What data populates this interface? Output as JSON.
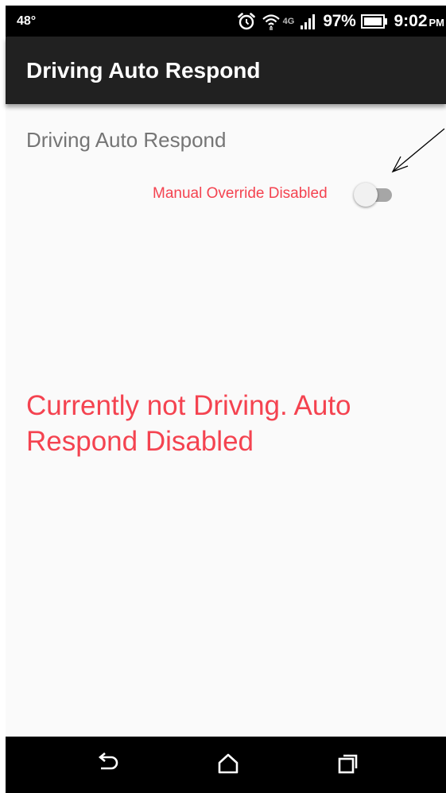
{
  "status_bar": {
    "temperature": "48°",
    "battery_percent": "97%",
    "time": "9:02",
    "ampm": "PM",
    "network": "4G",
    "icons": [
      "alarm-clock-icon",
      "wifi-icon",
      "signal-icon",
      "battery-icon"
    ]
  },
  "app_bar": {
    "title": "Driving Auto Respond"
  },
  "main": {
    "section_label": "Driving Auto Respond",
    "override": {
      "label": "Manual Override Disabled",
      "enabled": false
    },
    "status_message": "Currently not Driving. Auto Respond Disabled"
  },
  "nav_bar": {
    "icons": [
      "back-icon",
      "home-icon",
      "recents-icon"
    ]
  },
  "colors": {
    "accent_red": "#f44350",
    "app_bar": "#212121",
    "background": "#fafafa",
    "label_gray": "#757575"
  }
}
